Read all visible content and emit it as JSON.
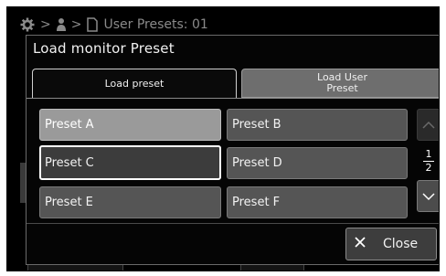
{
  "background": {
    "breadcrumb": {
      "home_icon": "gear-icon",
      "user_icon": "user-icon",
      "file_icon": "file-icon",
      "sep1": ">",
      "sep2": ">",
      "current": "User Presets: 01"
    },
    "close_label": "Close"
  },
  "dialog": {
    "title": "Load monitor Preset",
    "tabs": [
      {
        "label": "Load preset",
        "active": true
      },
      {
        "label": "Load User\nPreset",
        "active": false
      }
    ],
    "presets": [
      {
        "label": "Preset A",
        "state": "selected"
      },
      {
        "label": "Preset B",
        "state": "normal"
      },
      {
        "label": "Preset C",
        "state": "focused"
      },
      {
        "label": "Preset D",
        "state": "normal"
      },
      {
        "label": "Preset E",
        "state": "normal"
      },
      {
        "label": "Preset F",
        "state": "normal"
      }
    ],
    "page": {
      "current": "1",
      "total": "2"
    },
    "close_button": {
      "label": "Close",
      "icon": "close-icon"
    }
  },
  "colors": {
    "background": "#000000",
    "button": "#555555",
    "selected": "#9a9a9a",
    "inactive_tab": "#6e6e6e",
    "text": "#f2f2f2"
  }
}
